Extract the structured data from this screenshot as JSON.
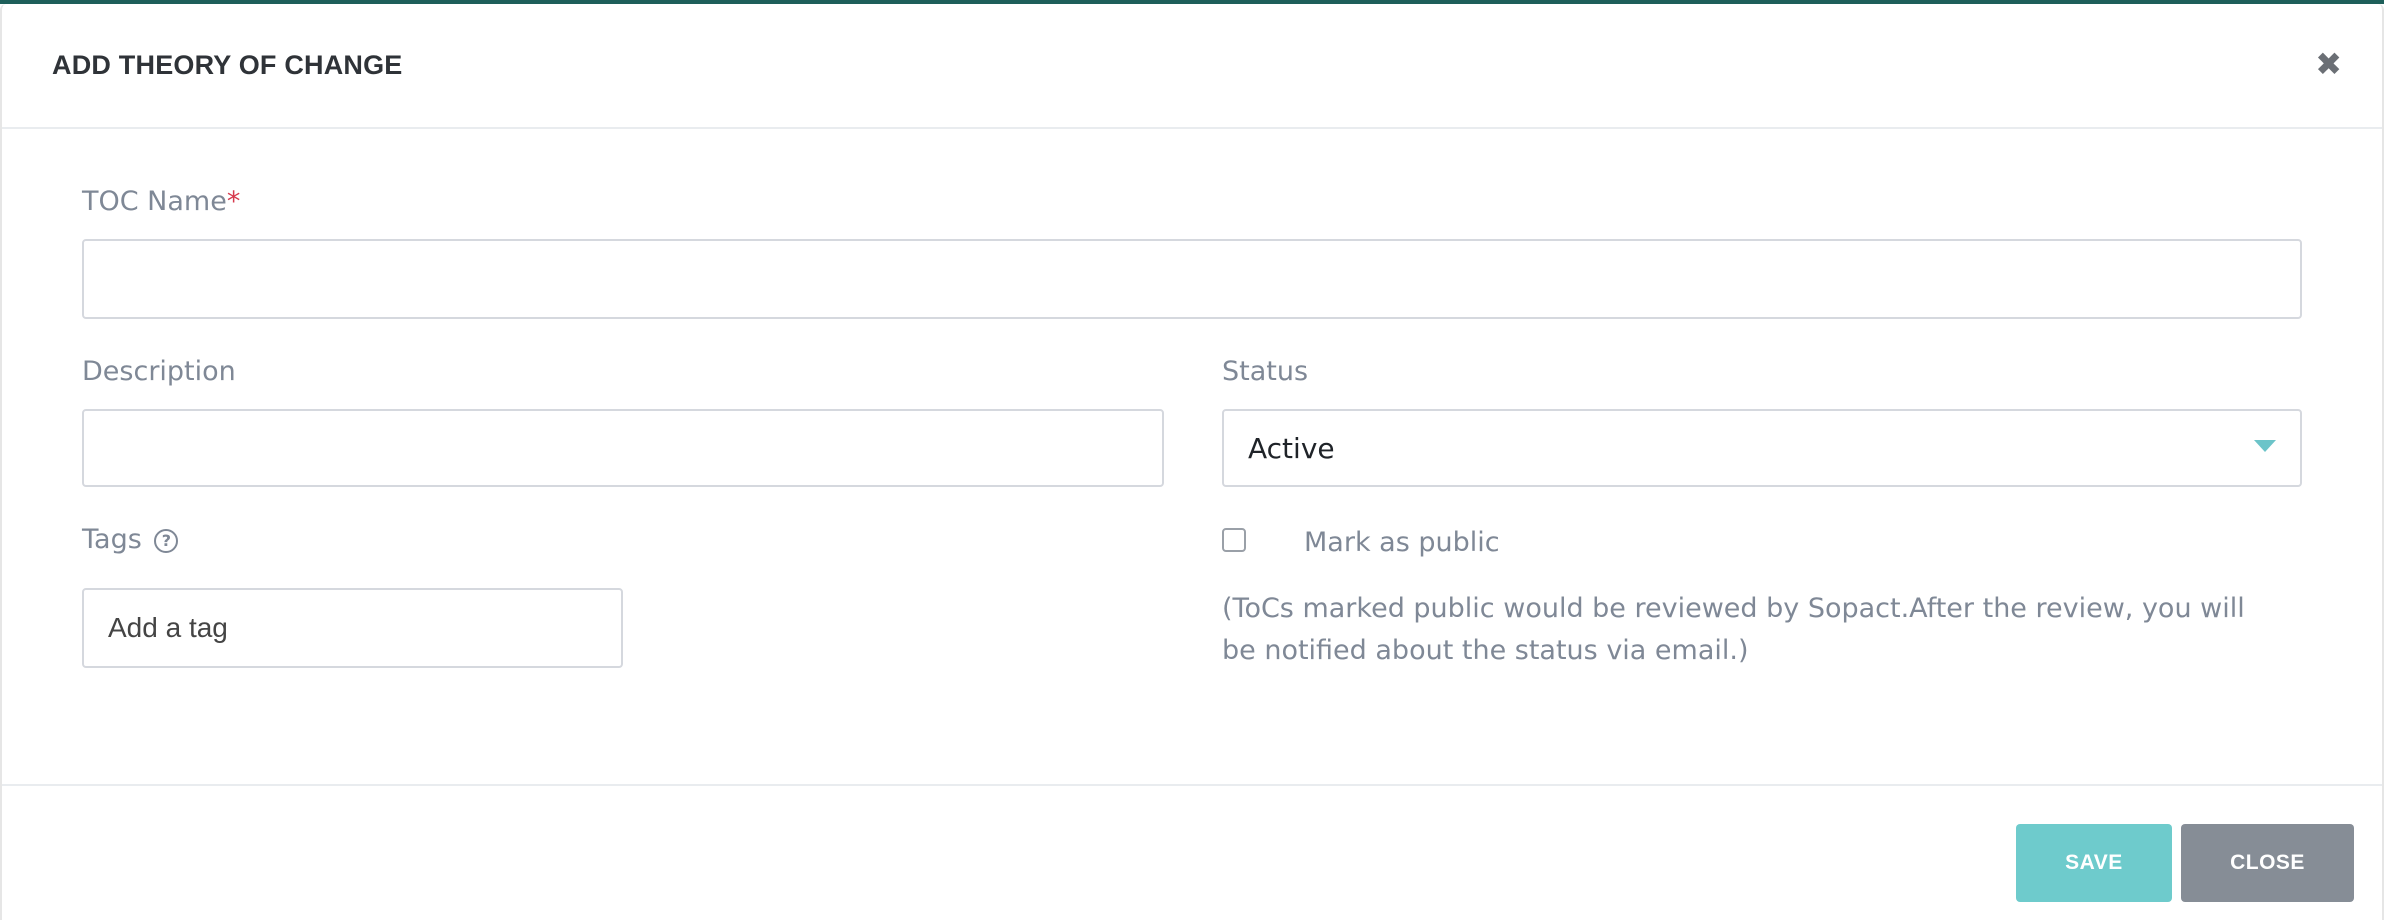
{
  "modal": {
    "title": "ADD THEORY OF CHANGE",
    "close_icon": "close-icon"
  },
  "form": {
    "toc_name": {
      "label": "TOC Name",
      "required_mark": "*",
      "value": "",
      "placeholder": ""
    },
    "description": {
      "label": "Description",
      "value": "",
      "placeholder": ""
    },
    "status": {
      "label": "Status",
      "selected": "Active"
    },
    "tags": {
      "label": "Tags",
      "help_icon": "question-circle-icon",
      "help_glyph": "?",
      "placeholder": "Add a tag"
    },
    "public": {
      "label": "Mark as public",
      "checked": false,
      "note": "(ToCs marked public would be reviewed by Sopact.After the review, you will be notified about the status via email.)"
    }
  },
  "footer": {
    "save_label": "SAVE",
    "close_label": "CLOSE"
  },
  "colors": {
    "accent": "#6ecbcc",
    "secondary": "#868d96",
    "required": "#d63a4d"
  }
}
